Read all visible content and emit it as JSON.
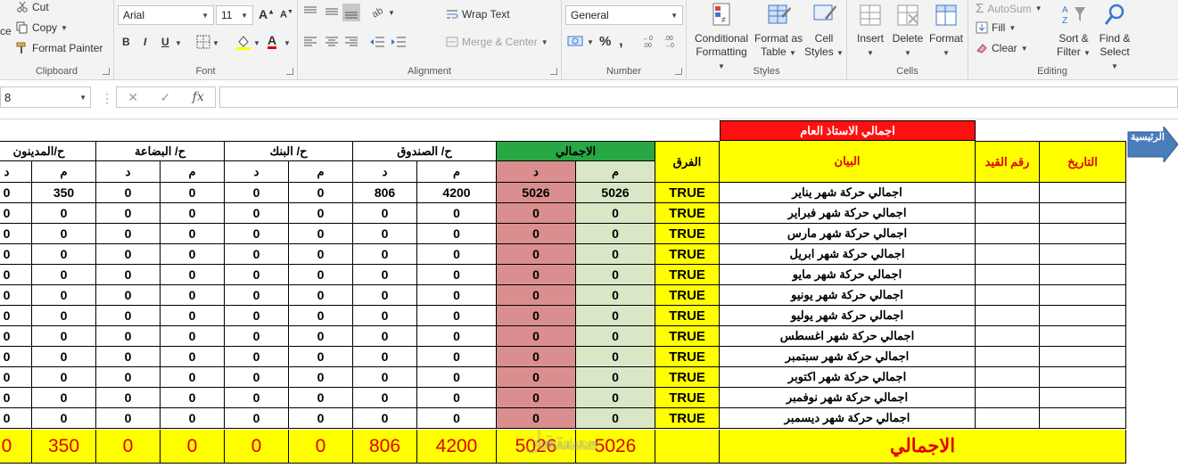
{
  "ribbon": {
    "clipboard": {
      "paste_fragment": "ce",
      "cut": "Cut",
      "copy": "Copy",
      "format_painter": "Format Painter",
      "label": "Clipboard"
    },
    "font": {
      "font_name": "Arial",
      "font_size": "11",
      "bold": "B",
      "italic": "I",
      "underline": "U",
      "grow": "A",
      "shrink": "A",
      "font_color_letter": "A",
      "label": "Font"
    },
    "alignment": {
      "wrap_text": "Wrap Text",
      "merge_center": "Merge & Center",
      "label": "Alignment"
    },
    "number": {
      "format": "General",
      "percent": "%",
      "comma": ",",
      "label": "Number"
    },
    "styles": {
      "conditional_1": "Conditional",
      "conditional_2": "Formatting",
      "format_table_1": "Format as",
      "format_table_2": "Table",
      "cell_styles_1": "Cell",
      "cell_styles_2": "Styles",
      "label": "Styles"
    },
    "cells": {
      "insert": "Insert",
      "delete": "Delete",
      "format": "Format",
      "label": "Cells"
    },
    "editing": {
      "autosum": "AutoSum",
      "fill": "Fill",
      "clear": "Clear",
      "sort_1": "Sort &",
      "sort_2": "Filter",
      "find_1": "Find &",
      "find_2": "Select",
      "label": "Editing"
    }
  },
  "formula_bar": {
    "name_box": "8",
    "cancel": "✕",
    "enter": "✓",
    "fx": "fx",
    "value": ""
  },
  "sheet": {
    "title": "اجمالي الاستاذ العام",
    "home_button": "الرئيسية",
    "headers": {
      "date": "التاريخ",
      "entry_no": "رقم القيد",
      "statement": "البيان",
      "difference": "الفرق",
      "total": "الاجمالي",
      "cash": "ح/ الصندوق",
      "bank": "ح/ البنك",
      "goods": "ح/ البضاعة",
      "debtors": "ح/المدينون",
      "debit": "م",
      "credit": "د"
    },
    "rows": [
      {
        "statement": "اجمالي  حركة شهر يناير",
        "diff": "TRUE",
        "tot_m": "5026",
        "tot_d": "5026",
        "cash_m": "4200",
        "cash_d": "806",
        "bank_m": "0",
        "bank_d": "0",
        "goods_m": "0",
        "goods_d": "0",
        "debt_m": "350",
        "debt_d": "0"
      },
      {
        "statement": "اجمالي  حركة شهر فبراير",
        "diff": "TRUE",
        "tot_m": "0",
        "tot_d": "0",
        "cash_m": "0",
        "cash_d": "0",
        "bank_m": "0",
        "bank_d": "0",
        "goods_m": "0",
        "goods_d": "0",
        "debt_m": "0",
        "debt_d": "0"
      },
      {
        "statement": "اجمالي  حركة شهر مارس",
        "diff": "TRUE",
        "tot_m": "0",
        "tot_d": "0",
        "cash_m": "0",
        "cash_d": "0",
        "bank_m": "0",
        "bank_d": "0",
        "goods_m": "0",
        "goods_d": "0",
        "debt_m": "0",
        "debt_d": "0"
      },
      {
        "statement": "اجمالي  حركة شهر ابريل",
        "diff": "TRUE",
        "tot_m": "0",
        "tot_d": "0",
        "cash_m": "0",
        "cash_d": "0",
        "bank_m": "0",
        "bank_d": "0",
        "goods_m": "0",
        "goods_d": "0",
        "debt_m": "0",
        "debt_d": "0"
      },
      {
        "statement": "اجمالي  حركة شهر مايو",
        "diff": "TRUE",
        "tot_m": "0",
        "tot_d": "0",
        "cash_m": "0",
        "cash_d": "0",
        "bank_m": "0",
        "bank_d": "0",
        "goods_m": "0",
        "goods_d": "0",
        "debt_m": "0",
        "debt_d": "0"
      },
      {
        "statement": "اجمالي  حركة شهر يونيو",
        "diff": "TRUE",
        "tot_m": "0",
        "tot_d": "0",
        "cash_m": "0",
        "cash_d": "0",
        "bank_m": "0",
        "bank_d": "0",
        "goods_m": "0",
        "goods_d": "0",
        "debt_m": "0",
        "debt_d": "0"
      },
      {
        "statement": "اجمالي  حركة شهر يوليو",
        "diff": "TRUE",
        "tot_m": "0",
        "tot_d": "0",
        "cash_m": "0",
        "cash_d": "0",
        "bank_m": "0",
        "bank_d": "0",
        "goods_m": "0",
        "goods_d": "0",
        "debt_m": "0",
        "debt_d": "0"
      },
      {
        "statement": "اجمالي  حركة شهر اغسطس",
        "diff": "TRUE",
        "tot_m": "0",
        "tot_d": "0",
        "cash_m": "0",
        "cash_d": "0",
        "bank_m": "0",
        "bank_d": "0",
        "goods_m": "0",
        "goods_d": "0",
        "debt_m": "0",
        "debt_d": "0"
      },
      {
        "statement": "اجمالي  حركة شهر سبتمبر",
        "diff": "TRUE",
        "tot_m": "0",
        "tot_d": "0",
        "cash_m": "0",
        "cash_d": "0",
        "bank_m": "0",
        "bank_d": "0",
        "goods_m": "0",
        "goods_d": "0",
        "debt_m": "0",
        "debt_d": "0"
      },
      {
        "statement": "اجمالي  حركة شهر اكتوبر",
        "diff": "TRUE",
        "tot_m": "0",
        "tot_d": "0",
        "cash_m": "0",
        "cash_d": "0",
        "bank_m": "0",
        "bank_d": "0",
        "goods_m": "0",
        "goods_d": "0",
        "debt_m": "0",
        "debt_d": "0"
      },
      {
        "statement": "اجمالي  حركة شهر نوفمبر",
        "diff": "TRUE",
        "tot_m": "0",
        "tot_d": "0",
        "cash_m": "0",
        "cash_d": "0",
        "bank_m": "0",
        "bank_d": "0",
        "goods_m": "0",
        "goods_d": "0",
        "debt_m": "0",
        "debt_d": "0"
      },
      {
        "statement": "اجمالي  حركة شهر ديسمبر",
        "diff": "TRUE",
        "tot_m": "0",
        "tot_d": "0",
        "cash_m": "0",
        "cash_d": "0",
        "bank_m": "0",
        "bank_d": "0",
        "goods_m": "0",
        "goods_d": "0",
        "debt_m": "0",
        "debt_d": "0"
      }
    ],
    "totals": {
      "label": "الاجمالي",
      "tot_m": "5026",
      "tot_d": "5026",
      "cash_m": "4200",
      "cash_d": "806",
      "bank_m": "0",
      "bank_d": "0",
      "goods_m": "0",
      "goods_d": "0",
      "debt_m": "350",
      "debt_d": "0"
    },
    "watermark": "مستقل",
    "watermark_sub": "mostaql.com",
    "colors": {
      "yellow": "#ffff00",
      "title_red": "#ff1010",
      "debit_green": "#d9e7c7",
      "credit_red": "#db8e8e",
      "total_header_green": "#27a845"
    }
  }
}
